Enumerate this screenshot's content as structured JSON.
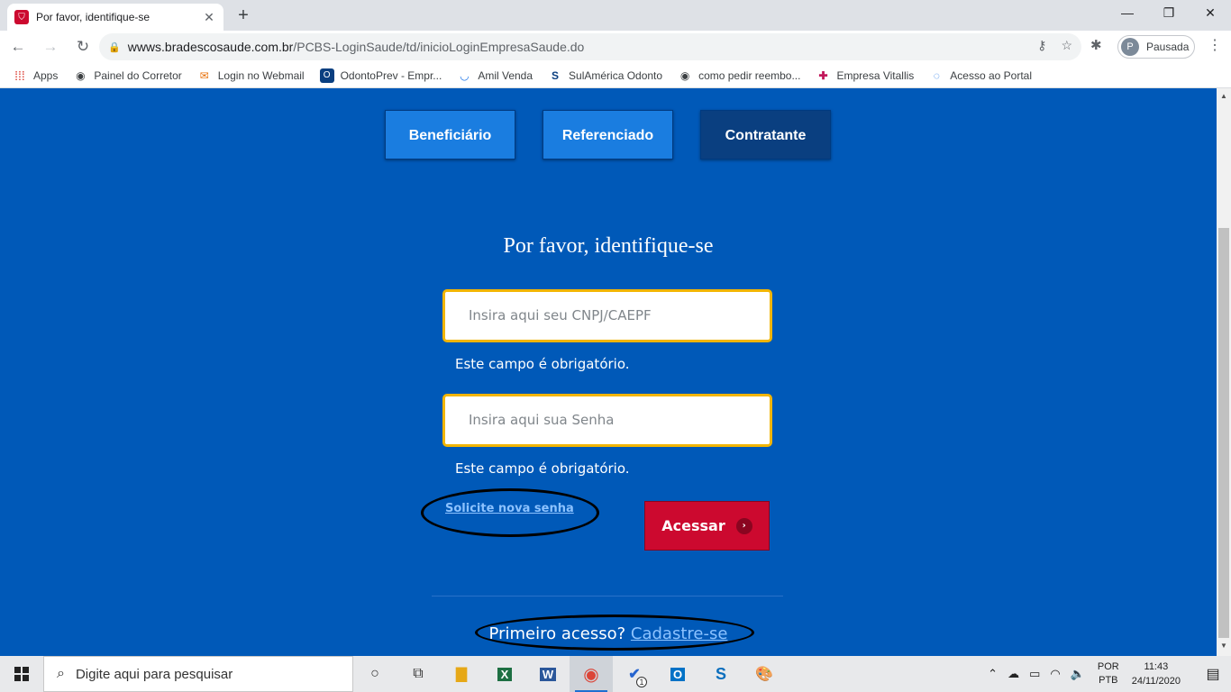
{
  "browser": {
    "tab_title": "Por favor, identifique-se",
    "url_host": "wwws.bradescosaude.com.br",
    "url_path": "/PCBS-LoginSaude/td/inicioLoginEmpresaSaude.do",
    "profile_initial": "P",
    "profile_label": "Pausada",
    "bookmarks": [
      {
        "label": "Apps",
        "icon": "apps-grid-icon"
      },
      {
        "label": "Painel do Corretor",
        "icon": "globe-icon"
      },
      {
        "label": "Login no Webmail",
        "icon": "webmail-icon"
      },
      {
        "label": "OdontoPrev - Empr...",
        "icon": "odontoprev-icon"
      },
      {
        "label": "Amil Venda",
        "icon": "amil-icon"
      },
      {
        "label": "SulAmérica Odonto",
        "icon": "sulamerica-icon"
      },
      {
        "label": "como pedir reembo...",
        "icon": "globe-icon"
      },
      {
        "label": "Empresa Vitallis",
        "icon": "cross-icon"
      },
      {
        "label": "Acesso ao Portal",
        "icon": "portal-icon"
      }
    ]
  },
  "page": {
    "tabs": [
      "Beneficiário",
      "Referenciado",
      "Contratante"
    ],
    "active_tab": "Contratante",
    "heading": "Por favor, identifique-se",
    "cnpj_placeholder": "Insira aqui seu CNPJ/CAEPF",
    "password_placeholder": "Insira aqui sua Senha",
    "required_msg_1": "Este campo é obrigatório.",
    "required_msg_2": "Este campo é obrigatório.",
    "forgot_link": "Solicite nova senha",
    "submit_label": "Acessar",
    "first_access_text": "Primeiro acesso?",
    "register_link": "Cadastre-se"
  },
  "taskbar": {
    "search_placeholder": "Digite aqui para pesquisar",
    "lang_top": "POR",
    "lang_bottom": "PTB",
    "time": "11:43",
    "date": "24/11/2020",
    "todo_badge": "1"
  },
  "colors": {
    "page_bg": "#0059b8",
    "tab_inactive": "#1a7de0",
    "tab_active": "#0a3f80",
    "field_border": "#f2b500",
    "submit_bg": "#cc092f",
    "link": "#8cc2ff"
  }
}
